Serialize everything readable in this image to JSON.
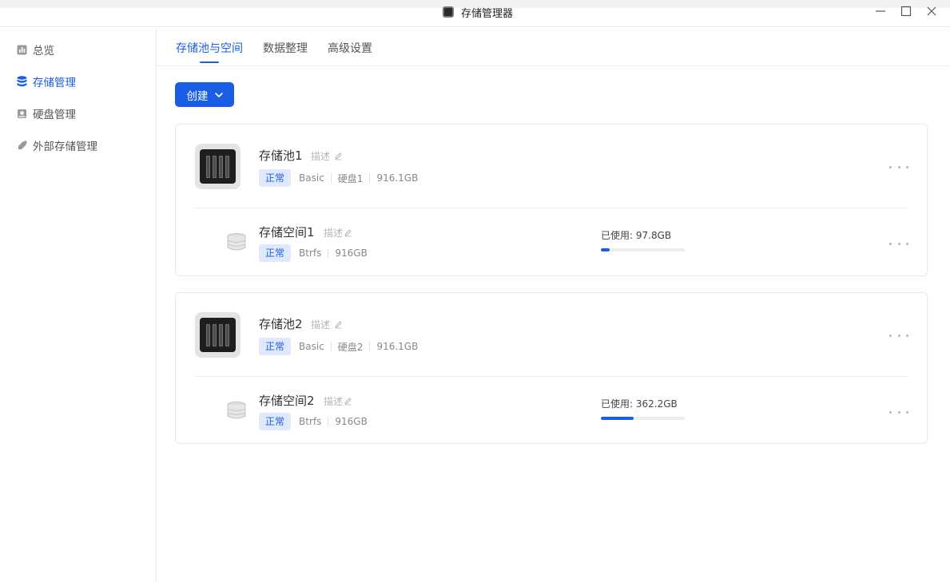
{
  "window": {
    "title": "存储管理器"
  },
  "sidebar": {
    "items": [
      {
        "label": "总览",
        "icon": "chart-box-icon",
        "active": false
      },
      {
        "label": "存储管理",
        "icon": "database-icon",
        "active": true
      },
      {
        "label": "硬盘管理",
        "icon": "hard-disk-icon",
        "active": false
      },
      {
        "label": "外部存储管理",
        "icon": "usb-drive-icon",
        "active": false
      }
    ]
  },
  "tabs": [
    {
      "label": "存储池与空间",
      "active": true
    },
    {
      "label": "数据整理",
      "active": false
    },
    {
      "label": "高级设置",
      "active": false
    }
  ],
  "create_button": {
    "label": "创建"
  },
  "pools": [
    {
      "name": "存储池1",
      "desc_label": "描述",
      "status": "正常",
      "type": "Basic",
      "disk": "硬盘1",
      "size": "916.1GB",
      "volume": {
        "name": "存储空间1",
        "desc_label": "描述",
        "status": "正常",
        "fs": "Btrfs",
        "size": "916GB",
        "usage_text": "已使用: 97.8GB",
        "usage_fraction": 0.107
      }
    },
    {
      "name": "存储池2",
      "desc_label": "描述",
      "status": "正常",
      "type": "Basic",
      "disk": "硬盘2",
      "size": "916.1GB",
      "volume": {
        "name": "存储空间2",
        "desc_label": "描述",
        "status": "正常",
        "fs": "Btrfs",
        "size": "916GB",
        "usage_text": "已使用: 362.2GB",
        "usage_fraction": 0.395
      }
    }
  ],
  "colors": {
    "accent": "#1a5ee6",
    "badge_bg": "#dfe9fb",
    "muted_text": "#888888"
  }
}
